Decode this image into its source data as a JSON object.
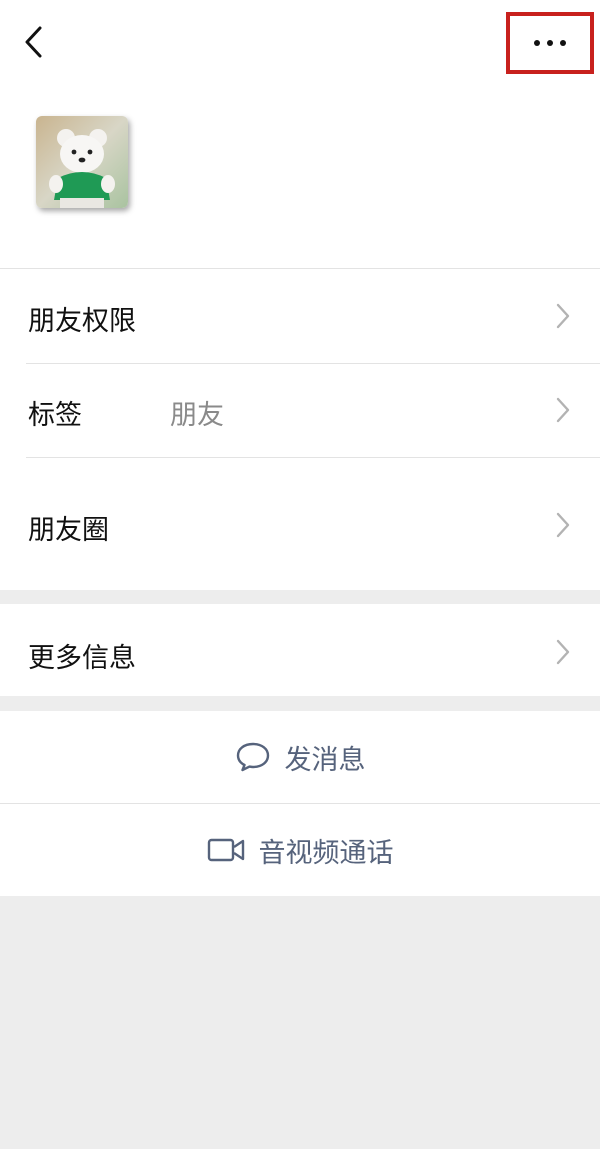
{
  "header": {
    "back_icon": "chevron-left-icon",
    "more_icon": "more-dots-icon",
    "highlight_color": "#c8211d"
  },
  "profile": {
    "avatar_icon": "bear-avatar"
  },
  "settings": {
    "friend_permissions_label": "朋友权限",
    "tags_label": "标签",
    "tags_value": "朋友",
    "moments_label": "朋友圈",
    "more_info_label": "更多信息"
  },
  "actions": {
    "send_message_label": "发消息",
    "send_message_icon": "chat-bubble-icon",
    "video_call_label": "音视频通话",
    "video_call_icon": "video-camera-icon",
    "accent_color": "#56637c"
  }
}
